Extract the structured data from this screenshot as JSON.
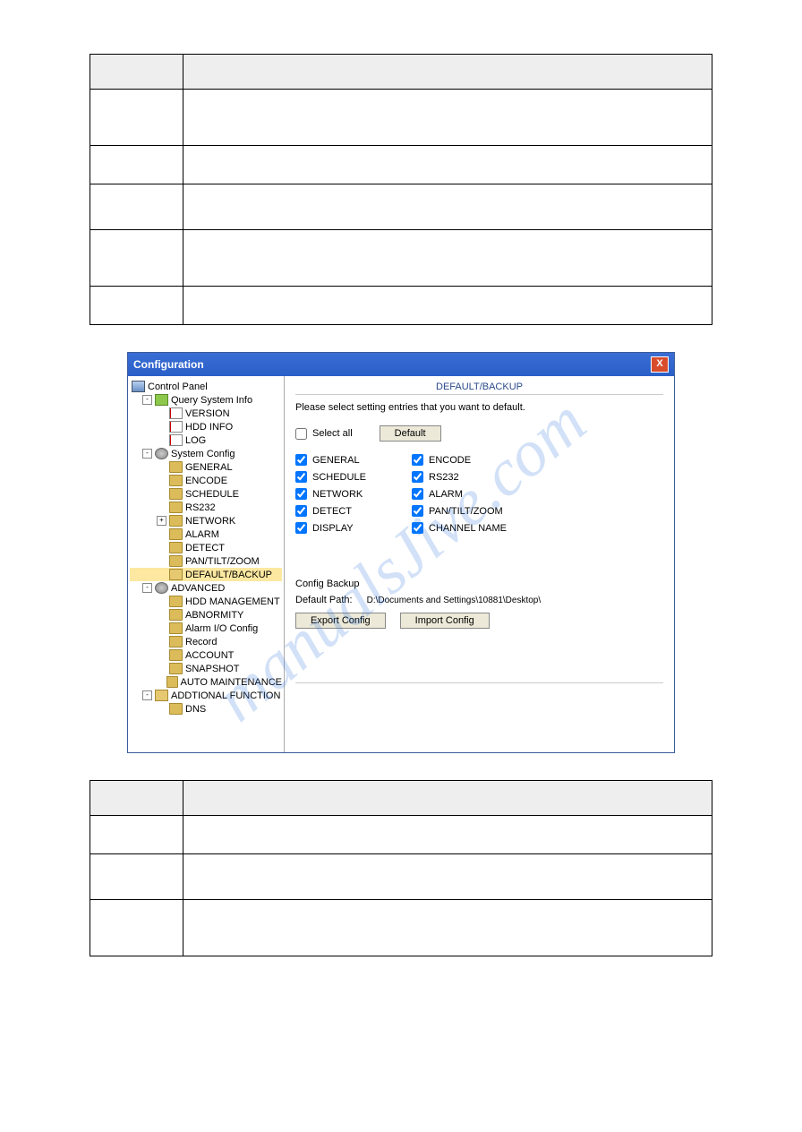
{
  "tables": {
    "top": {
      "header": [
        "",
        ""
      ],
      "rows": [
        [
          "",
          ""
        ],
        [
          "",
          ""
        ],
        [
          "",
          ""
        ],
        [
          "",
          ""
        ],
        [
          "",
          ""
        ]
      ]
    },
    "bottom": {
      "header": [
        "",
        ""
      ],
      "rows": [
        [
          "",
          ""
        ],
        [
          "",
          ""
        ],
        [
          "",
          ""
        ]
      ]
    }
  },
  "watermark": "manualsJive.com",
  "window": {
    "title": "Configuration",
    "close": "X",
    "tree": {
      "root": "Control Panel",
      "groups": [
        {
          "label": "Query System Info",
          "icon": "brush",
          "expanded": true,
          "children": [
            {
              "label": "VERSION",
              "icon": "page"
            },
            {
              "label": "HDD INFO",
              "icon": "page"
            },
            {
              "label": "LOG",
              "icon": "page"
            }
          ]
        },
        {
          "label": "System Config",
          "icon": "gear",
          "expanded": true,
          "children": [
            {
              "label": "GENERAL",
              "icon": "folder"
            },
            {
              "label": "ENCODE",
              "icon": "folder"
            },
            {
              "label": "SCHEDULE",
              "icon": "folder"
            },
            {
              "label": "RS232",
              "icon": "folder"
            },
            {
              "label": "NETWORK",
              "icon": "folder",
              "expandable": true
            },
            {
              "label": "ALARM",
              "icon": "folder"
            },
            {
              "label": "DETECT",
              "icon": "folder"
            },
            {
              "label": "PAN/TILT/ZOOM",
              "icon": "folder"
            },
            {
              "label": "DEFAULT/BACKUP",
              "icon": "folder-open",
              "selected": true
            }
          ]
        },
        {
          "label": "ADVANCED",
          "icon": "gear",
          "expanded": true,
          "children": [
            {
              "label": "HDD MANAGEMENT",
              "icon": "folder"
            },
            {
              "label": "ABNORMITY",
              "icon": "folder"
            },
            {
              "label": "Alarm I/O Config",
              "icon": "folder"
            },
            {
              "label": "Record",
              "icon": "folder"
            },
            {
              "label": "ACCOUNT",
              "icon": "folder"
            },
            {
              "label": "SNAPSHOT",
              "icon": "folder"
            },
            {
              "label": "AUTO MAINTENANCE",
              "icon": "folder"
            }
          ]
        },
        {
          "label": "ADDTIONAL FUNCTION",
          "icon": "folder-open",
          "expanded": true,
          "children": [
            {
              "label": "DNS",
              "icon": "folder"
            }
          ]
        }
      ]
    },
    "panel": {
      "heading": "DEFAULT/BACKUP",
      "instruction": "Please select setting entries that you want to default.",
      "select_all_label": "Select all",
      "select_all_checked": false,
      "default_button": "Default",
      "checks_left": [
        {
          "label": "GENERAL",
          "checked": true
        },
        {
          "label": "SCHEDULE",
          "checked": true
        },
        {
          "label": "NETWORK",
          "checked": true
        },
        {
          "label": "DETECT",
          "checked": true
        },
        {
          "label": "DISPLAY",
          "checked": true
        }
      ],
      "checks_right": [
        {
          "label": "ENCODE",
          "checked": true
        },
        {
          "label": "RS232",
          "checked": true
        },
        {
          "label": "ALARM",
          "checked": true
        },
        {
          "label": "PAN/TILT/ZOOM",
          "checked": true
        },
        {
          "label": "CHANNEL NAME",
          "checked": true
        }
      ],
      "config_backup": {
        "title": "Config Backup",
        "path_label": "Default Path:",
        "path_value": "D:\\Documents and Settings\\10881\\Desktop\\",
        "export_button": "Export Config",
        "import_button": "Import Config"
      }
    }
  }
}
